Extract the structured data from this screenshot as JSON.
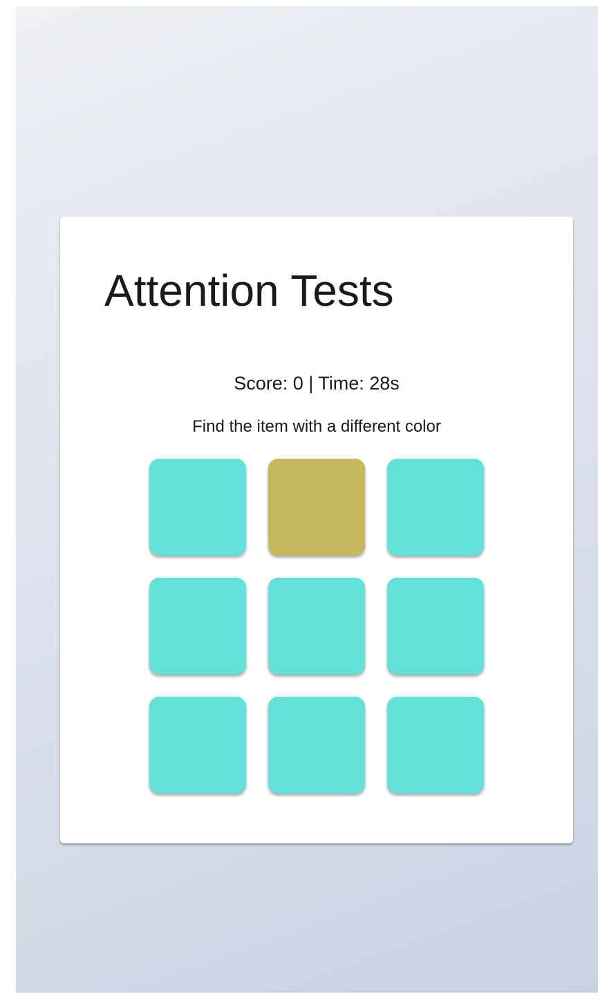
{
  "game": {
    "title": "Attention Tests",
    "status": "Score: 0 | Time: 28s",
    "instruction": "Find the item with a different color"
  },
  "colors": {
    "base_tile": "#64e0d8",
    "odd_tile": "#c6b85c"
  },
  "grid": {
    "rows": 3,
    "cols": 3,
    "odd_index": 1
  }
}
